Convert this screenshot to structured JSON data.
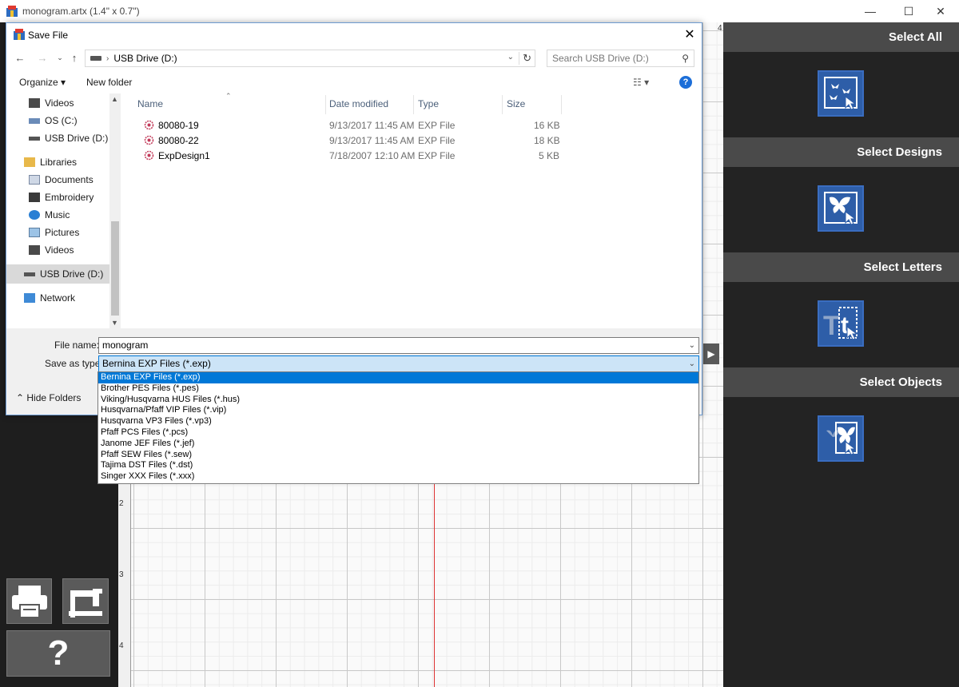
{
  "app": {
    "title": "monogram.artx (1.4\" x 0.7\")",
    "minimize": "—",
    "maximize": "☐",
    "close": "✕"
  },
  "right_panel": {
    "sections": [
      {
        "label": "Select All",
        "icon": "select-all-icon"
      },
      {
        "label": "Select Designs",
        "icon": "select-designs-icon"
      },
      {
        "label": "Select Letters",
        "icon": "select-letters-icon"
      },
      {
        "label": "Select Objects",
        "icon": "select-objects-icon"
      }
    ]
  },
  "canvas": {
    "ruler_numbers": [
      "2",
      "3",
      "4"
    ],
    "top_ruler_mark": "4"
  },
  "tools": {
    "help_label": "?"
  },
  "dialog": {
    "title": "Save File",
    "close": "✕",
    "address": {
      "location": "USB Drive (D:)"
    },
    "search_placeholder": "Search USB Drive (D:)",
    "toolbar": {
      "organize": "Organize ▾",
      "new_folder": "New folder",
      "view_icon": "☷ ▾",
      "help": "?"
    },
    "nav_items": [
      {
        "label": "Videos",
        "icon": "video-folder-icon"
      },
      {
        "label": "OS (C:)",
        "icon": "drive-icon"
      },
      {
        "label": "USB Drive (D:)",
        "icon": "usb-drive-icon"
      },
      {
        "label": "Libraries",
        "icon": "libraries-icon"
      },
      {
        "label": "Documents",
        "icon": "documents-icon"
      },
      {
        "label": "Embroidery",
        "icon": "embroidery-folder-icon"
      },
      {
        "label": "Music",
        "icon": "music-icon"
      },
      {
        "label": "Pictures",
        "icon": "pictures-icon"
      },
      {
        "label": "Videos",
        "icon": "video-folder-icon"
      },
      {
        "label": "USB Drive (D:)",
        "icon": "usb-drive-icon"
      },
      {
        "label": "Network",
        "icon": "network-icon"
      }
    ],
    "columns": {
      "name": "Name",
      "date": "Date modified",
      "type": "Type",
      "size": "Size"
    },
    "files": [
      {
        "name": "80080-19",
        "date": "9/13/2017 11:45 AM",
        "type": "EXP File",
        "size": "16 KB"
      },
      {
        "name": "80080-22",
        "date": "9/13/2017 11:45 AM",
        "type": "EXP File",
        "size": "18 KB"
      },
      {
        "name": "ExpDesign1",
        "date": "7/18/2007 12:10 AM",
        "type": "EXP File",
        "size": "5 KB"
      }
    ],
    "file_name_label": "File name:",
    "file_name_value": "monogram",
    "save_type_label": "Save as type:",
    "save_type_value": "Bernina EXP Files (*.exp)",
    "hide_folders": "Hide Folders",
    "type_options": [
      "Bernina EXP Files (*.exp)",
      "Brother PES Files (*.pes)",
      "Viking/Husqvarna HUS Files (*.hus)",
      "Husqvarna/Pfaff VIP Files (*.vip)",
      "Husqvarna VP3 Files (*.vp3)",
      "Pfaff PCS Files (*.pcs)",
      "Janome JEF Files (*.jef)",
      "Pfaff SEW Files (*.sew)",
      "Tajima DST Files (*.dst)",
      "Singer XXX Files (*.xxx)"
    ]
  },
  "colors": {
    "accent": "#0078d7",
    "panel_header": "#4a4a4a",
    "icon_tile": "#2e5ea8",
    "guide_line": "#dd3333"
  }
}
